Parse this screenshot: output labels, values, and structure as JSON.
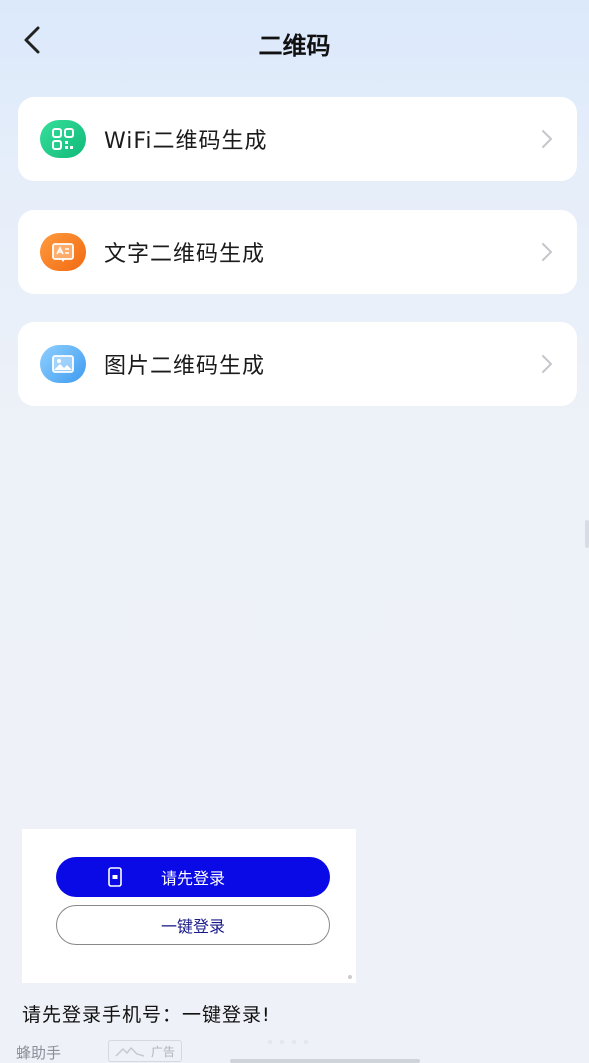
{
  "header": {
    "title": "二维码"
  },
  "menu": {
    "items": [
      {
        "label": "WiFi二维码生成",
        "icon": "qr-code-icon",
        "color": "#1fcb8a"
      },
      {
        "label": "文字二维码生成",
        "icon": "text-card-icon",
        "color": "#f7801f"
      },
      {
        "label": "图片二维码生成",
        "icon": "image-icon",
        "color": "#5aaef5"
      }
    ]
  },
  "ad": {
    "login_primary_label": "请先登录",
    "login_secondary_label": "一键登录",
    "caption": "请先登录手机号：一键登录!",
    "brand": "蜂助手",
    "tag": "广告",
    "primary_color": "#0a0ae6"
  }
}
